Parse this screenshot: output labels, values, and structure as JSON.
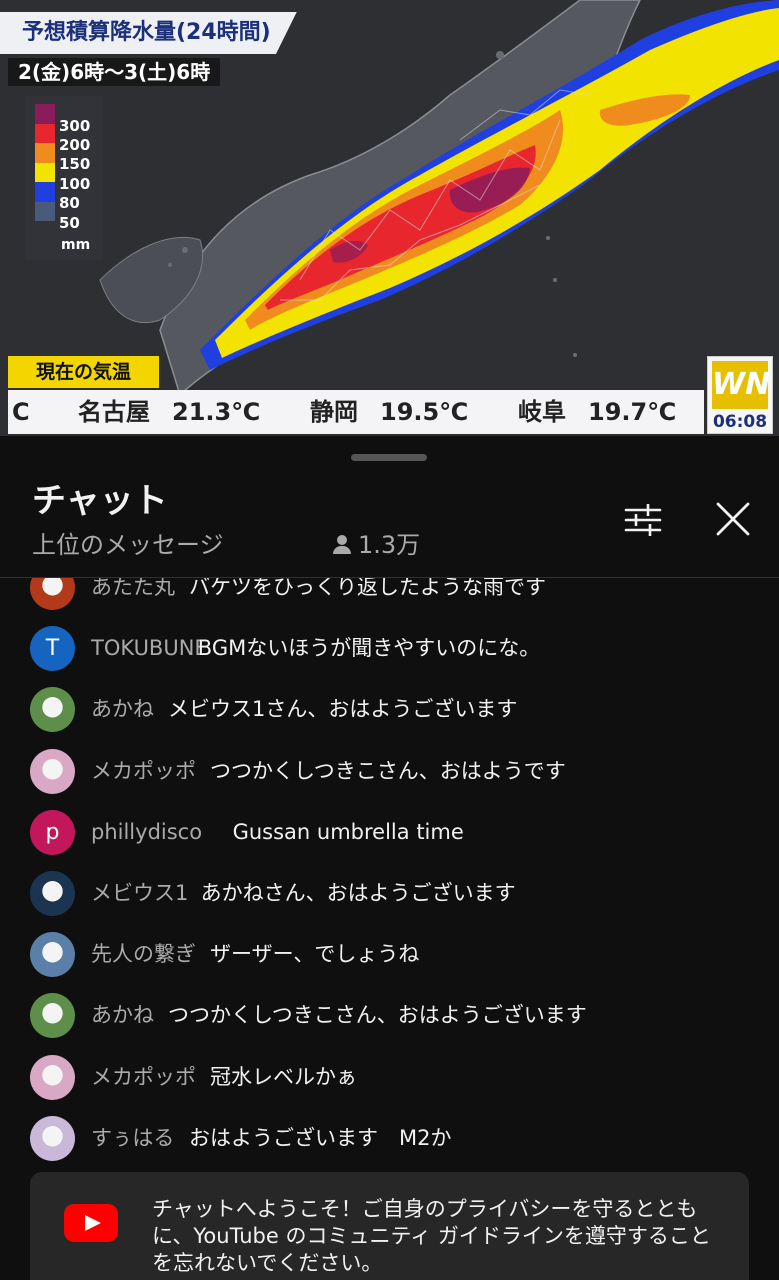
{
  "video": {
    "title": "予想積算降水量(24時間)",
    "date_range": "2(金)6時～3(土)6時",
    "legend": {
      "unit": "mm",
      "levels": [
        {
          "label": "300",
          "color": "#8a1c5a"
        },
        {
          "label": "200",
          "color": "#e8262e"
        },
        {
          "label": "150",
          "color": "#f08c1e"
        },
        {
          "label": "100",
          "color": "#f2e400"
        },
        {
          "label": "80",
          "color": "#1f3fe0"
        },
        {
          "label": "50",
          "color": "#4a5a7a"
        }
      ]
    },
    "current_temp_label": "現在の気温",
    "temps": [
      {
        "city": "C",
        "value": ""
      },
      {
        "city": "名古屋",
        "value": "21.3℃"
      },
      {
        "city": "静岡",
        "value": "19.5℃"
      },
      {
        "city": "岐阜",
        "value": "19.7℃"
      }
    ],
    "logo": "WN",
    "clock": "06:08"
  },
  "chat": {
    "title": "チャット",
    "filter_label": "上位のメッセージ",
    "viewer_count": "1.3万",
    "messages": [
      {
        "author": "あたた丸",
        "text": "バケツをひっくり返したような雨です",
        "avatar": {
          "type": "image",
          "color": "#b23a1a"
        }
      },
      {
        "author": "TOKUBUNE",
        "text": "BGMないほうが聞きやすいのにな。",
        "avatar": {
          "type": "letter",
          "letter": "T",
          "color": "#1565c0"
        }
      },
      {
        "author": "あかね",
        "text": "メビウス1さん、おはようございます",
        "avatar": {
          "type": "image",
          "color": "#5d8f4a"
        }
      },
      {
        "author": "メカポッポ",
        "text": "つつかくしつきこさん、おはようです",
        "avatar": {
          "type": "image",
          "color": "#d9a8c4"
        }
      },
      {
        "author": "phillydisco",
        "text": "Gussan umbrella time",
        "avatar": {
          "type": "letter",
          "letter": "p",
          "color": "#c2185b"
        }
      },
      {
        "author": "メビウス1",
        "text": "あかねさん、おはようございます",
        "avatar": {
          "type": "image",
          "color": "#1b3550"
        }
      },
      {
        "author": "先人の繋ぎ",
        "text": "ザーザー、でしょうね",
        "avatar": {
          "type": "image",
          "color": "#5a7fa8"
        }
      },
      {
        "author": "あかね",
        "text": "つつかくしつきこさん、おはようございます",
        "avatar": {
          "type": "image",
          "color": "#5d8f4a"
        }
      },
      {
        "author": "メカポッポ",
        "text": "冠水レベルかぁ",
        "avatar": {
          "type": "image",
          "color": "#d9a8c4"
        }
      },
      {
        "author": "すぅはる",
        "text": "おはようございます　M2か",
        "avatar": {
          "type": "image",
          "color": "#c9b8d8"
        }
      }
    ],
    "welcome_text": "チャットへようこそ！ご自身のプライバシーを守るとともに、YouTube のコミュニティ ガイドラインを遵守することを忘れないでください。"
  },
  "icons": [
    "filter-sliders-icon",
    "close-icon",
    "person-icon",
    "youtube-logo-icon"
  ],
  "colors": {
    "background": "#0f0f0f",
    "secondary_text": "#aaaaaa",
    "primary_text": "#f1f1f1",
    "accent": "#ff0000"
  }
}
